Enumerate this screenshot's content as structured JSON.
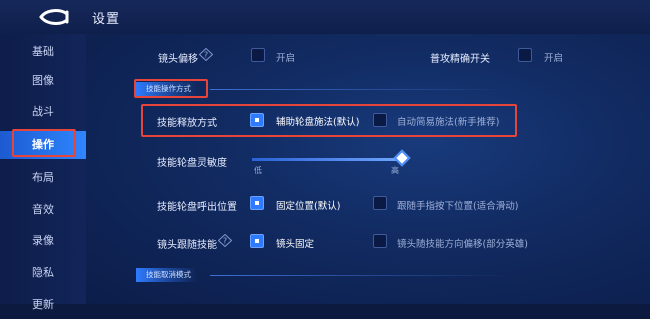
{
  "header": {
    "title": "设置"
  },
  "sidebar": {
    "items": [
      {
        "label": "基础"
      },
      {
        "label": "图像"
      },
      {
        "label": "战斗"
      },
      {
        "label": "操作"
      },
      {
        "label": "布局"
      },
      {
        "label": "音效"
      },
      {
        "label": "录像"
      },
      {
        "label": "隐私"
      },
      {
        "label": "更新"
      }
    ],
    "active_index": 3
  },
  "settings": {
    "camera_offset": {
      "label": "镜头偏移",
      "option": "开启"
    },
    "precise_attack": {
      "label": "普攻精确开关",
      "option": "开启"
    },
    "skill_section_title": "技能操作方式",
    "skill_cast": {
      "label": "技能释放方式",
      "option_a": "辅助轮盘施法(默认)",
      "option_b": "自动简易施法(新手推荐)"
    },
    "wheel_sensitivity": {
      "label": "技能轮盘灵敏度",
      "low": "低",
      "high": "高",
      "value_fraction": 1.0
    },
    "wheel_position": {
      "label": "技能轮盘呼出位置",
      "option_a": "固定位置(默认)",
      "option_b": "跟随手指按下位置(适合滑动)"
    },
    "camera_follow": {
      "label": "镜头跟随技能",
      "option_a": "镜头固定",
      "option_b": "镜头随技能方向偏移(部分英雄)"
    },
    "cancel_section_title": "技能取消模式"
  },
  "colors": {
    "accent": "#2f7bff",
    "highlight_frame": "#e7443a",
    "background": "#0c1a3f"
  }
}
